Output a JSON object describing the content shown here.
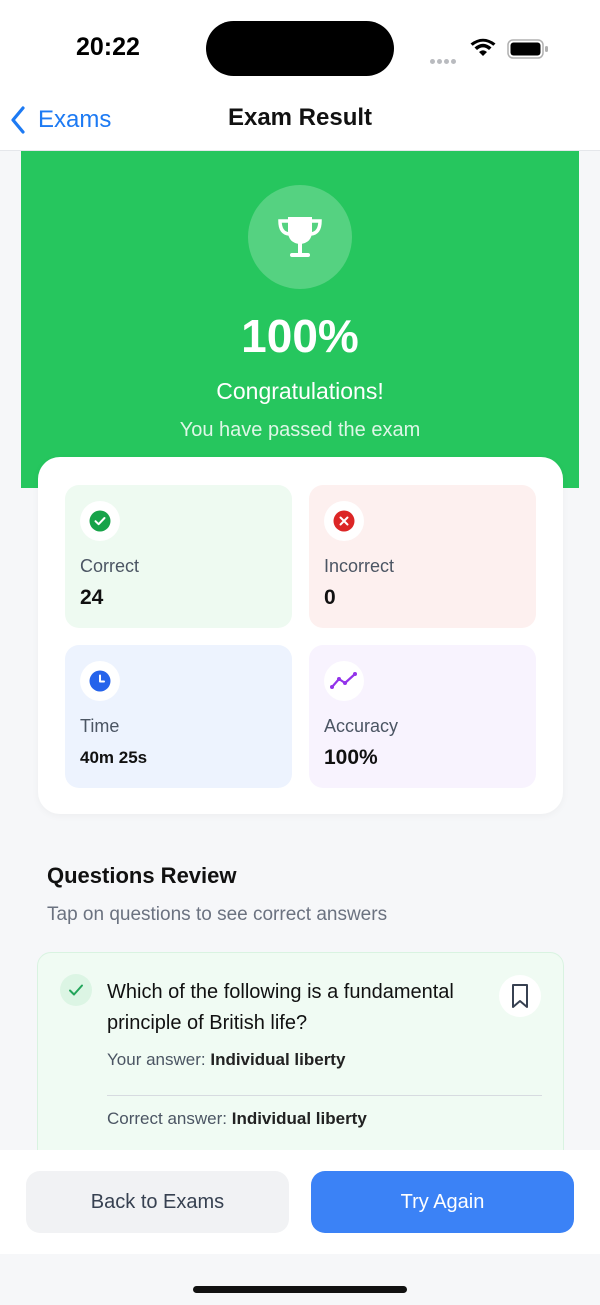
{
  "status_bar": {
    "time": "20:22"
  },
  "nav": {
    "back_label": "Exams",
    "title": "Exam Result"
  },
  "hero": {
    "score": "100%",
    "title": "Congratulations!",
    "subtitle": "You have passed the exam",
    "color": "#26c65e"
  },
  "stats": {
    "correct": {
      "label": "Correct",
      "value": "24",
      "icon": "check-circle-icon",
      "color": "#17a349"
    },
    "incorrect": {
      "label": "Incorrect",
      "value": "0",
      "icon": "x-circle-icon",
      "color": "#dc2626"
    },
    "time": {
      "label": "Time",
      "value": "40m 25s",
      "icon": "clock-icon",
      "color": "#2563eb"
    },
    "accuracy": {
      "label": "Accuracy",
      "value": "100%",
      "icon": "trend-line-icon",
      "color": "#9333ea"
    }
  },
  "review": {
    "title": "Questions Review",
    "subtitle": "Tap on questions to see correct answers",
    "questions": [
      {
        "text": "Which of the following is a fundamental principle of British life?",
        "your_answer_label": "Your answer:",
        "your_answer": "Individual liberty",
        "correct_answer_label": "Correct answer:",
        "correct_answer": "Individual liberty",
        "status": "correct"
      }
    ]
  },
  "actions": {
    "back_label": "Back to Exams",
    "try_again_label": "Try Again",
    "accent": "#3b82f6"
  }
}
